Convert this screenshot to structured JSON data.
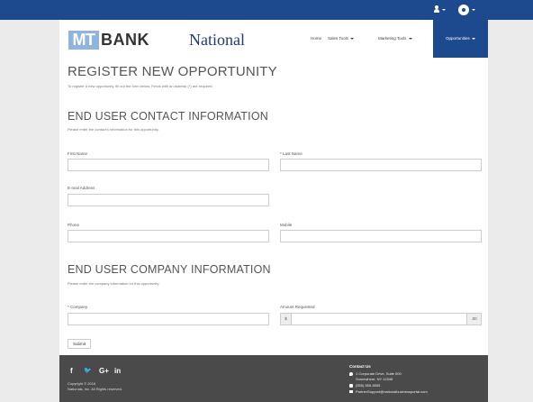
{
  "topbar": {
    "user_icon": "user-icon",
    "settings_icon": "gear-icon"
  },
  "nav": {
    "logo_mt": "MT",
    "logo_bank": "BANK",
    "logo_national": "National",
    "links": [
      "Home",
      "Sales Tools",
      "Marketing Tools",
      "Opportunities"
    ]
  },
  "page": {
    "title": "REGISTER NEW OPPORTUNITY",
    "intro": "To register a new opportunity, fill out the form below. Fields with an asterisk (*) are required."
  },
  "contact_section": {
    "title": "END USER CONTACT INFORMATION",
    "desc": "Please enter the contact's information for this opportunity.",
    "first_name_label": "First Name",
    "last_name_label": "* Last Name",
    "email_label": "E-mail Address",
    "phone_label": "Phone",
    "mobile_label": "Mobile"
  },
  "company_section": {
    "title": "END USER COMPANY INFORMATION",
    "desc": "Please enter the company information for this opportunity.",
    "company_label": "* Company",
    "amount_label": "Amount Requested",
    "amount_prefix": "$",
    "amount_suffix": ".00"
  },
  "submit_label": "Submit",
  "footer": {
    "social_icons": [
      "facebook-icon",
      "twitter-icon",
      "google-plus-icon",
      "linkedin-icon"
    ],
    "social_facebook": "f",
    "social_twitter": "🐦",
    "social_google": "G+",
    "social_linkedin": "in",
    "copyright_line1": "Copyright © 2016",
    "copyright_line2": "Nationals, Inc. All Rights reserved.",
    "contact_heading": "Contact Us",
    "address_line1": "1 Corporate Drive, Suite 000",
    "address_line2": "Somewhere, NY 12345",
    "phone": "(555) 555-5555",
    "email": "PartnerSupport@nationalbusinessportal.com"
  },
  "colors": {
    "brand_blue": "#1d4a8e",
    "logo_light_blue": "#8fb4dd",
    "footer_gray": "#4a4a4a",
    "page_bg": "#ebebeb"
  }
}
